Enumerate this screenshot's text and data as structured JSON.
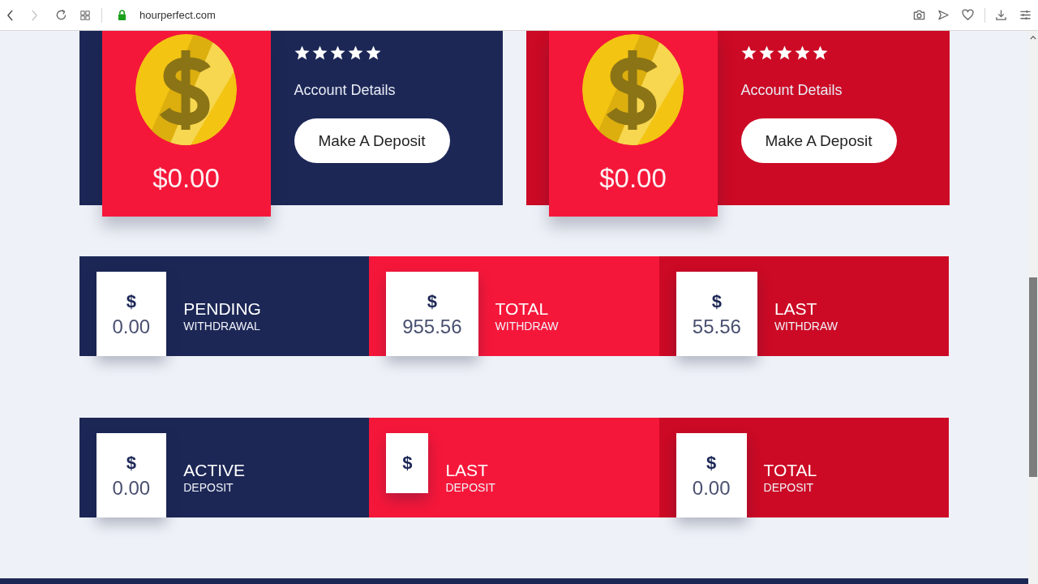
{
  "browser": {
    "url": "hourperfect.com",
    "nav": [
      {
        "kind": "back",
        "disabled": false
      },
      {
        "kind": "forward",
        "disabled": true
      }
    ]
  },
  "plans": [
    {
      "color": "#1c2756",
      "amount": "$0.00",
      "stars": 5,
      "title": "Account Details",
      "button": "Make A Deposit"
    },
    {
      "color": "#cc0a25",
      "amount": "$0.00",
      "stars": 5,
      "title": "Account Details",
      "button": "Make A Deposit"
    }
  ],
  "stat_rows": [
    [
      {
        "color": "#1c2756",
        "currency": "$",
        "value": "0.00",
        "title": "PENDING",
        "subtitle": "WITHDRAWAL"
      },
      {
        "color": "#f5173a",
        "currency": "$",
        "value": "955.56",
        "title": "TOTAL",
        "subtitle": "WITHDRAW"
      },
      {
        "color": "#cc0a25",
        "currency": "$",
        "value": "55.56",
        "title": "LAST",
        "subtitle": "WITHDRAW"
      }
    ],
    [
      {
        "color": "#1c2756",
        "currency": "$",
        "value": "0.00",
        "title": "ACTIVE",
        "subtitle": "DEPOSIT"
      },
      {
        "color": "#f5173a",
        "currency": "$",
        "title": "LAST",
        "subtitle": "DEPOSIT"
      },
      {
        "color": "#cc0a25",
        "currency": "$",
        "value": "0.00",
        "title": "TOTAL",
        "subtitle": "DEPOSIT"
      }
    ]
  ]
}
